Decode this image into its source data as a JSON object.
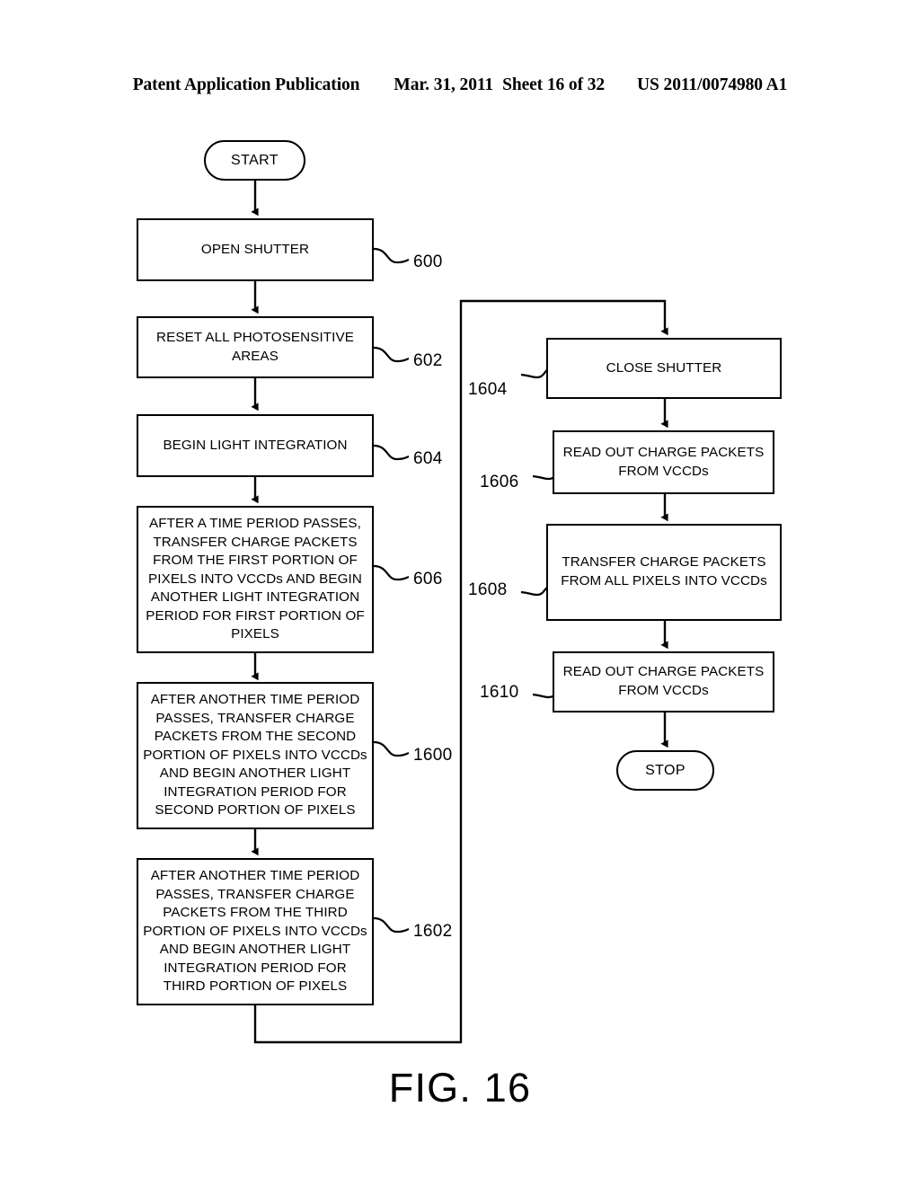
{
  "header": {
    "publication": "Patent Application Publication",
    "date": "Mar. 31, 2011",
    "sheet": "Sheet 16 of 32",
    "number": "US 2011/0074980 A1"
  },
  "figure": {
    "caption": "FIG. 16"
  },
  "flowchart": {
    "start_label": "START",
    "stop_label": "STOP",
    "left_column": [
      {
        "ref": "600",
        "text": "OPEN SHUTTER"
      },
      {
        "ref": "602",
        "text": "RESET ALL PHOTOSENSITIVE AREAS"
      },
      {
        "ref": "604",
        "text": "BEGIN LIGHT INTEGRATION"
      },
      {
        "ref": "606",
        "text": "AFTER A TIME PERIOD PASSES, TRANSFER CHARGE PACKETS FROM THE FIRST PORTION OF PIXELS INTO VCCDs AND BEGIN ANOTHER LIGHT INTEGRATION PERIOD FOR FIRST PORTION OF PIXELS"
      },
      {
        "ref": "1600",
        "text": "AFTER ANOTHER TIME PERIOD PASSES, TRANSFER CHARGE PACKETS FROM THE SECOND PORTION OF PIXELS INTO VCCDs AND BEGIN ANOTHER LIGHT INTEGRATION PERIOD FOR SECOND PORTION OF PIXELS"
      },
      {
        "ref": "1602",
        "text": "AFTER ANOTHER TIME PERIOD PASSES, TRANSFER CHARGE PACKETS FROM THE THIRD PORTION OF PIXELS INTO VCCDs AND BEGIN ANOTHER LIGHT INTEGRATION PERIOD FOR THIRD PORTION OF PIXELS"
      }
    ],
    "right_column": [
      {
        "ref": "1604",
        "text": "CLOSE SHUTTER"
      },
      {
        "ref": "1606",
        "text": "READ OUT CHARGE PACKETS FROM VCCDs"
      },
      {
        "ref": "1608",
        "text": "TRANSFER CHARGE PACKETS FROM ALL PIXELS INTO VCCDs"
      },
      {
        "ref": "1610",
        "text": "READ OUT CHARGE PACKETS FROM VCCDs"
      }
    ]
  }
}
